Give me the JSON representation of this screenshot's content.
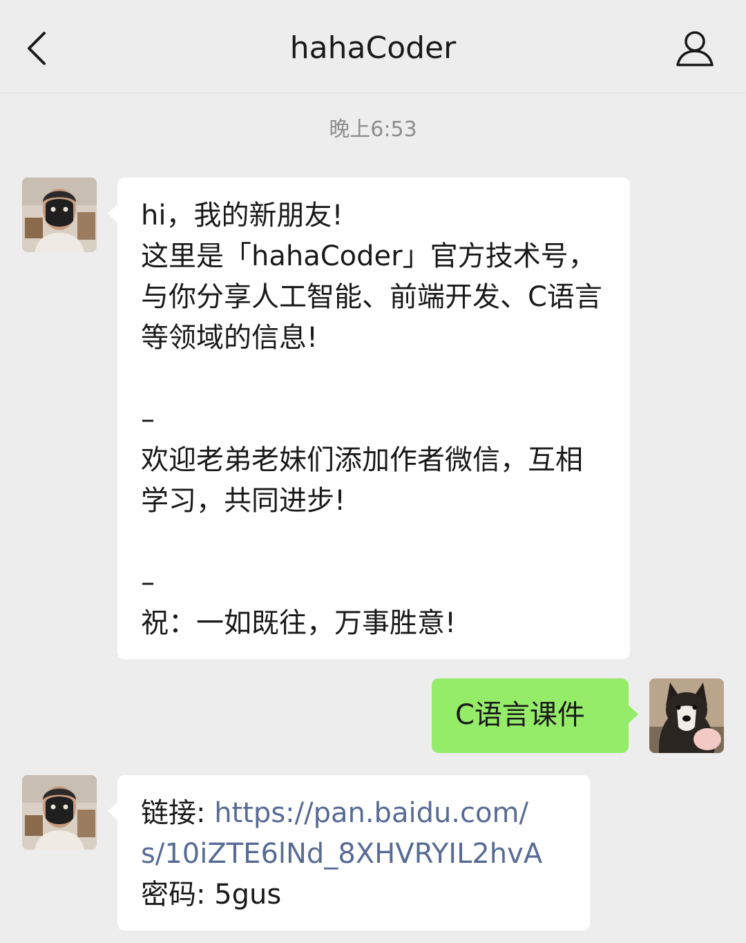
{
  "header": {
    "title": "hahaCoder",
    "back_icon": "chevron-left-icon",
    "profile_icon": "person-icon"
  },
  "messages": {
    "timestamp": "晚上6:53",
    "welcome": {
      "sender": "hahaCoder",
      "line1": "hi，我的新朋友!",
      "para1": "这里是「hahaCoder」官方技术号，与你分享人工智能、前端开发、C语言等领域的信息!",
      "blank1": "",
      "dash1": "–",
      "para2": "欢迎老弟老妹们添加作者微信，互相学习，共同进步!",
      "blank2": "",
      "dash2": "–",
      "line_last": "祝：一如既往，万事胜意!"
    },
    "user_query": {
      "sender": "me",
      "text": "C语言课件"
    },
    "reply": {
      "sender": "hahaCoder",
      "link_label": "链接: ",
      "link_part1": "https://pan.baidu.com/",
      "link_part2": "s/10iZTE6lNd_8XHVRYIL2hvA",
      "password_label": "密码: ",
      "password": "5gus"
    }
  },
  "colors": {
    "background": "#ededed",
    "incoming_bubble": "#ffffff",
    "outgoing_bubble": "#95ec69",
    "link": "#576b95",
    "timestamp": "#8c8c8c"
  }
}
